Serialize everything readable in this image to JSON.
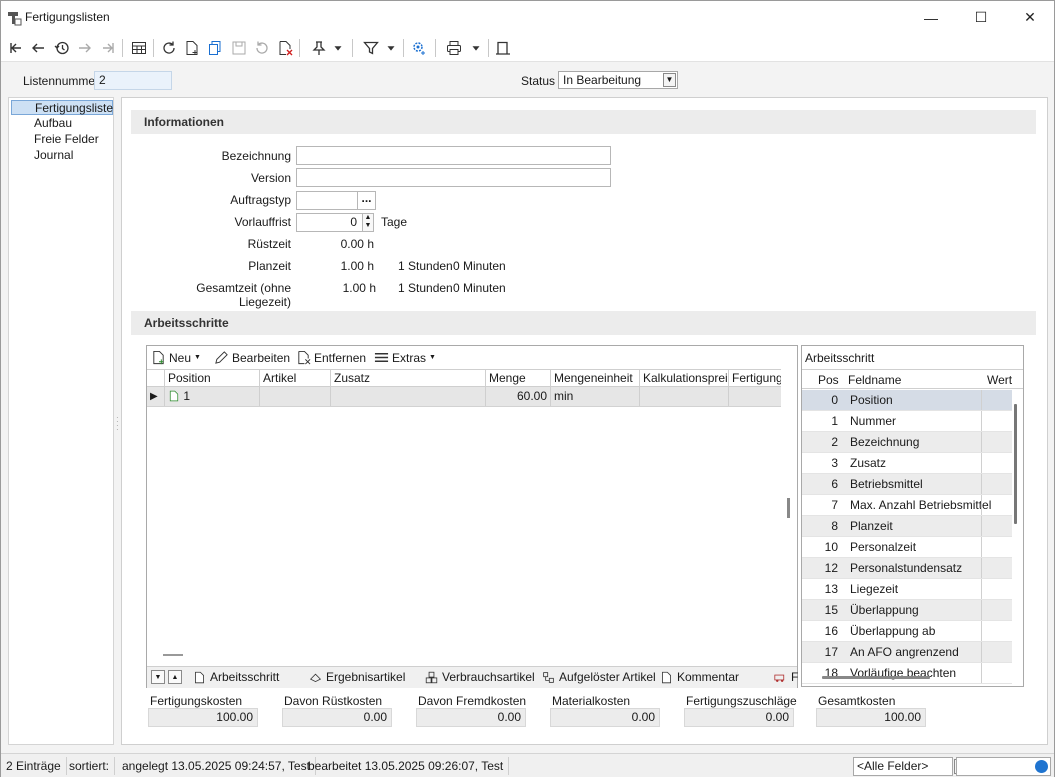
{
  "window": {
    "title": "Fertigungslisten"
  },
  "header": {
    "listennummer_label": "Listennummer",
    "listennummer_value": "2",
    "status_label": "Status",
    "status_value": "In Bearbeitung"
  },
  "nav": {
    "items": [
      "Fertigungsliste",
      "Aufbau",
      "Freie Felder",
      "Journal"
    ],
    "active_index": 0
  },
  "info": {
    "section_title": "Informationen",
    "bezeichnung_label": "Bezeichnung",
    "bezeichnung_value": "",
    "version_label": "Version",
    "version_value": "",
    "auftragstyp_label": "Auftragstyp",
    "auftragstyp_value": "",
    "ellipsis": "...",
    "vorlauffrist_label": "Vorlauffrist",
    "vorlauffrist_value": "0",
    "vorlauffrist_unit": "Tage",
    "ruestzeit_label": "Rüstzeit",
    "ruestzeit_value": "0.00 h",
    "planzeit_label": "Planzeit",
    "planzeit_value": "1.00 h",
    "planzeit_stunden": "1 Stunden",
    "planzeit_minuten": "0 Minuten",
    "gesamtzeit_label": "Gesamtzeit (ohne Liegezeit)",
    "gesamtzeit_value": "1.00 h",
    "gesamtzeit_stunden": "1 Stunden",
    "gesamtzeit_minuten": "0 Minuten"
  },
  "steps": {
    "section_title": "Arbeitsschritte",
    "toolbar": {
      "neu": "Neu",
      "bearbeiten": "Bearbeiten",
      "entfernen": "Entfernen",
      "extras": "Extras"
    },
    "columns": [
      "Position",
      "Artikel",
      "Zusatz",
      "Menge",
      "Mengeneinheit",
      "Kalkulationspreis",
      "Fertigungsl"
    ],
    "rows": [
      {
        "position": "1",
        "artikel": "",
        "zusatz": "",
        "menge": "60.00",
        "einheit": "min",
        "kalk": "",
        "fert": ""
      }
    ],
    "tabs": [
      "Arbeitsschritt",
      "Ergebnisartikel",
      "Verbrauchsartikel",
      "Aufgelöster Artikel",
      "Kommentar",
      "F"
    ]
  },
  "fields_panel": {
    "title": "Arbeitsschritt",
    "col_pos": "Pos",
    "col_name": "Feldname",
    "col_wert": "Wert",
    "rows": [
      {
        "pos": "0",
        "name": "Position"
      },
      {
        "pos": "1",
        "name": "Nummer"
      },
      {
        "pos": "2",
        "name": "Bezeichnung"
      },
      {
        "pos": "3",
        "name": "Zusatz"
      },
      {
        "pos": "6",
        "name": "Betriebsmittel"
      },
      {
        "pos": "7",
        "name": "Max. Anzahl Betriebsmittel"
      },
      {
        "pos": "8",
        "name": "Planzeit"
      },
      {
        "pos": "10",
        "name": "Personalzeit"
      },
      {
        "pos": "12",
        "name": "Personalstundensatz"
      },
      {
        "pos": "13",
        "name": "Liegezeit"
      },
      {
        "pos": "15",
        "name": "Überlappung"
      },
      {
        "pos": "16",
        "name": "Überlappung ab"
      },
      {
        "pos": "17",
        "name": "An AFO angrenzend"
      },
      {
        "pos": "18",
        "name": "Vorläufige beachten"
      }
    ]
  },
  "costs": {
    "fertigungskosten_label": "Fertigungskosten",
    "fertigungskosten_value": "100.00",
    "ruestkosten_label": "Davon Rüstkosten",
    "ruestkosten_value": "0.00",
    "fremdkosten_label": "Davon Fremdkosten",
    "fremdkosten_value": "0.00",
    "materialkosten_label": "Materialkosten",
    "materialkosten_value": "0.00",
    "zuschlaege_label": "Fertigungszuschläge",
    "zuschlaege_value": "0.00",
    "gesamtkosten_label": "Gesamtkosten",
    "gesamtkosten_value": "100.00"
  },
  "status": {
    "entries": "2 Einträge",
    "sortiert": "sortiert:",
    "angelegt": "angelegt 13.05.2025 09:24:57, Test",
    "bearbeitet": "bearbeitet 13.05.2025 09:26:07, Test",
    "filter_value": "<Alle Felder>"
  },
  "colors": {
    "accent": "#0a64c8",
    "selection": "#cde0f4",
    "row_alt": "#ececec"
  }
}
